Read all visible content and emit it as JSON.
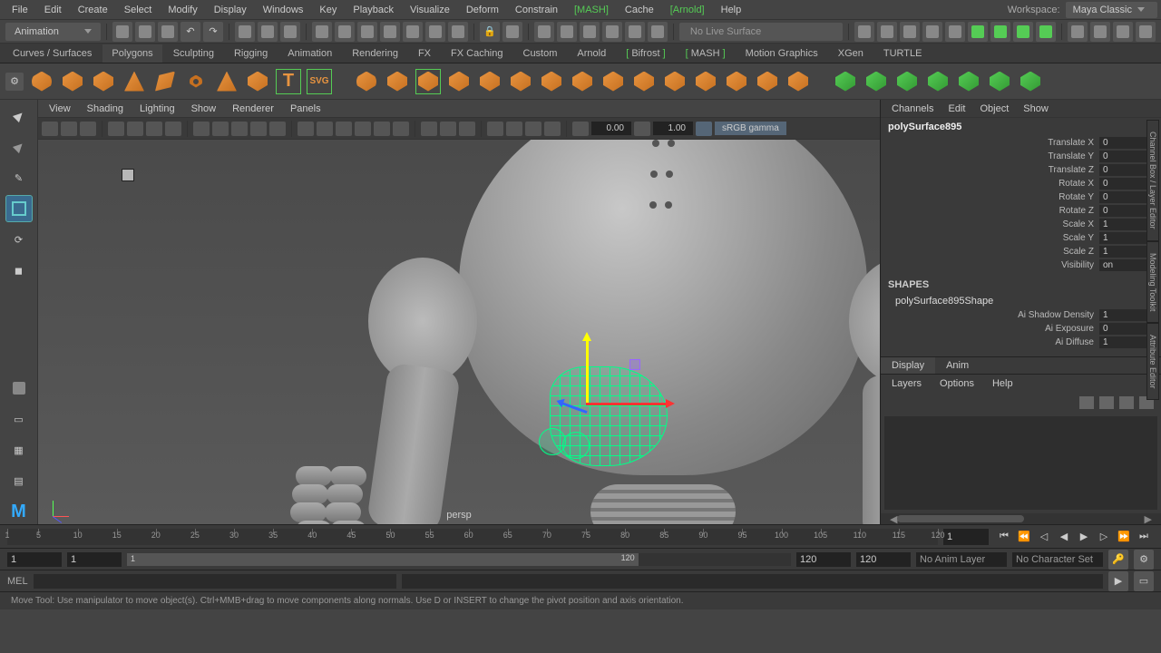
{
  "menubar": {
    "items": [
      "File",
      "Edit",
      "Create",
      "Select",
      "Modify",
      "Display",
      "Windows",
      "Key",
      "Playback",
      "Visualize",
      "Deform",
      "Constrain",
      "MASH",
      "Cache",
      "Arnold",
      "Help"
    ],
    "greenIndices": [
      12,
      14
    ],
    "workspace_label": "Workspace:",
    "workspace_value": "Maya Classic"
  },
  "mode_dropdown": "Animation",
  "nolive": "No Live Surface",
  "shelf_tabs": [
    "Curves / Surfaces",
    "Polygons",
    "Sculpting",
    "Rigging",
    "Animation",
    "Rendering",
    "FX",
    "FX Caching",
    "Custom",
    "Arnold",
    "Bifrost",
    "MASH",
    "Motion Graphics",
    "XGen",
    "TURTLE"
  ],
  "shelf_active": 1,
  "vp": {
    "menus": [
      "View",
      "Shading",
      "Lighting",
      "Show",
      "Renderer",
      "Panels"
    ],
    "field1": "0.00",
    "field2": "1.00",
    "gamma": "sRGB gamma",
    "cam": "persp"
  },
  "channelbox": {
    "menus": [
      "Channels",
      "Edit",
      "Object",
      "Show"
    ],
    "object": "polySurface895",
    "attrs": [
      {
        "label": "Translate X",
        "value": "0"
      },
      {
        "label": "Translate Y",
        "value": "0"
      },
      {
        "label": "Translate Z",
        "value": "0"
      },
      {
        "label": "Rotate X",
        "value": "0"
      },
      {
        "label": "Rotate Y",
        "value": "0"
      },
      {
        "label": "Rotate Z",
        "value": "0"
      },
      {
        "label": "Scale X",
        "value": "1"
      },
      {
        "label": "Scale Y",
        "value": "1"
      },
      {
        "label": "Scale Z",
        "value": "1"
      },
      {
        "label": "Visibility",
        "value": "on"
      }
    ],
    "shapes_header": "SHAPES",
    "shape_name": "polySurface895Shape",
    "shape_attrs": [
      {
        "label": "Ai Shadow Density",
        "value": "1"
      },
      {
        "label": "Ai Exposure",
        "value": "0"
      },
      {
        "label": "Ai Diffuse",
        "value": "1"
      }
    ],
    "tabs": [
      "Display",
      "Anim"
    ],
    "tab_active": 0,
    "layer_menus": [
      "Layers",
      "Options",
      "Help"
    ]
  },
  "sidetabs": [
    "Channel Box / Layer Editor",
    "Modeling Toolkit",
    "Attribute Editor"
  ],
  "timeline": {
    "start": 1,
    "end": 120,
    "ticks": [
      1,
      5,
      10,
      15,
      20,
      25,
      30,
      35,
      40,
      45,
      50,
      55,
      60,
      65,
      70,
      75,
      80,
      85,
      90,
      95,
      100,
      105,
      110,
      115,
      120
    ],
    "current": "1"
  },
  "range": {
    "min": "1",
    "start": "1",
    "inner": "1",
    "end": "120",
    "max": "120",
    "maxmax": "120",
    "animlayer": "No Anim Layer",
    "charset": "No Character Set"
  },
  "cmd": {
    "lang": "MEL"
  },
  "helpline": "Move Tool: Use manipulator to move object(s). Ctrl+MMB+drag to move components along normals. Use D or INSERT to change the pivot position and axis orientation."
}
